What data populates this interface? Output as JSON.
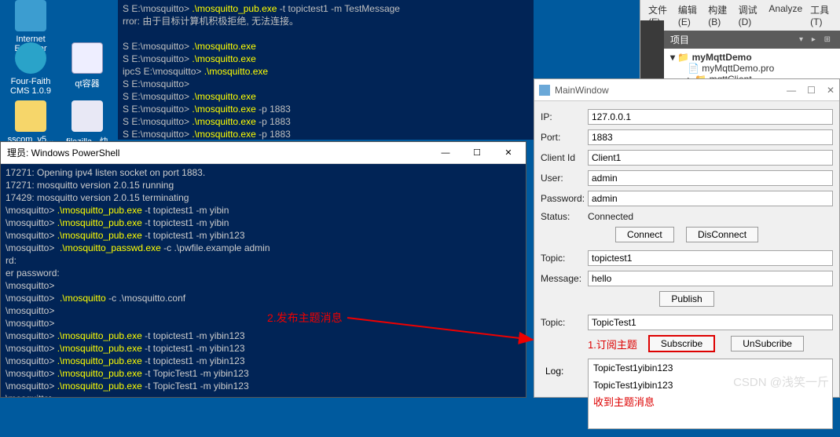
{
  "desktop": {
    "icons": [
      {
        "label": "Internet\nExplorer"
      },
      {
        "label": "Four-Faith\nCMS 1.0.9"
      },
      {
        "label": "qt容器"
      },
      {
        "label": "sscom_v5..."
      },
      {
        "label": "filezilla - 快 FF-..."
      }
    ]
  },
  "top_console": {
    "lines": [
      {
        "prompt": "S E:\\mosquitto> ",
        "cmd": ".\\mosquitto_pub.exe",
        "args": " -t topictest1 -m TestMessage"
      },
      {
        "plain": "rror: 由于目标计算机积极拒绝, 无法连接。"
      },
      {
        "plain": ""
      },
      {
        "prompt": "S E:\\mosquitto> ",
        "cmd": ".\\mosquitto.exe",
        "args": ""
      },
      {
        "prompt": "S E:\\mosquitto> ",
        "cmd": ".\\mosquitto.exe",
        "args": ""
      },
      {
        "prompt": "ipcS E:\\mosquitto> ",
        "cmd": ".\\mosquitto.exe",
        "args": ""
      },
      {
        "prompt": "S E:\\mosquitto> ",
        "cmd": "",
        "args": ""
      },
      {
        "prompt": "S E:\\mosquitto> ",
        "cmd": ".\\mosquitto.exe",
        "args": ""
      },
      {
        "prompt": "S E:\\mosquitto> ",
        "cmd": ".\\mosquitto.exe",
        "args": " -p 1883"
      },
      {
        "prompt": "S E:\\mosquitto> ",
        "cmd": ".\\mosquitto.exe",
        "args": " -p 1883"
      },
      {
        "prompt": "S E:\\mosquitto> ",
        "cmd": ".\\mosquitto.exe",
        "args": " -p 1883"
      }
    ]
  },
  "ps": {
    "title": "理员: Windows PowerShell",
    "min": "—",
    "max": "☐",
    "close": "✕",
    "lines": [
      {
        "plain": "17271: Opening ipv4 listen socket on port 1883."
      },
      {
        "plain": "17271: mosquitto version 2.0.15 running"
      },
      {
        "plain": "17429: mosquitto version 2.0.15 terminating"
      },
      {
        "prompt": "\\mosquitto> ",
        "cmd": ".\\mosquitto_pub.exe",
        "args": " -t topictest1 -m yibin"
      },
      {
        "prompt": "\\mosquitto> ",
        "cmd": ".\\mosquitto_pub.exe",
        "args": " -t topictest1 -m yibin"
      },
      {
        "prompt": "\\mosquitto> ",
        "cmd": ".\\mosquitto_pub.exe",
        "args": " -t topictest1 -m yibin123"
      },
      {
        "prompt": "\\mosquitto> ",
        "cmd": " .\\mosquitto_passwd.exe",
        "args": " -c .\\pwfile.example admin"
      },
      {
        "plain": "rd:"
      },
      {
        "plain": "er password:"
      },
      {
        "prompt": "\\mosquitto> ",
        "cmd": "",
        "args": ""
      },
      {
        "prompt": "\\mosquitto> ",
        "cmd": " .\\mosquitto",
        "args": " -c .\\mosquitto.conf"
      },
      {
        "prompt": "\\mosquitto> ",
        "cmd": "",
        "args": ""
      },
      {
        "prompt": "\\mosquitto> ",
        "cmd": "",
        "args": ""
      },
      {
        "prompt": "\\mosquitto> ",
        "cmd": ".\\mosquitto_pub.exe",
        "args": " -t topictest1 -m yibin123"
      },
      {
        "prompt": "\\mosquitto> ",
        "cmd": ".\\mosquitto_pub.exe",
        "args": " -t topictest1 -m yibin123"
      },
      {
        "prompt": "\\mosquitto> ",
        "cmd": ".\\mosquitto_pub.exe",
        "args": " -t topictest1 -m yibin123"
      },
      {
        "prompt": "\\mosquitto> ",
        "cmd": ".\\mosquitto_pub.exe",
        "args": " -t TopicTest1 -m yibin123"
      },
      {
        "prompt": "\\mosquitto> ",
        "cmd": ".\\mosquitto_pub.exe",
        "args": " -t TopicTest1 -m yibin123"
      },
      {
        "prompt": "\\mosquitto> ",
        "cmd": "_",
        "args": ""
      }
    ]
  },
  "ide": {
    "menus": [
      "文件(F)",
      "编辑(E)",
      "构建(B)",
      "调试(D)",
      "Analyze",
      "工具(T)"
    ],
    "project_header": "项目",
    "tree": {
      "folder": "myMqttDemo",
      "files": [
        "myMqttDemo.pro",
        "mqttClient"
      ]
    }
  },
  "mw": {
    "title": "MainWindow",
    "labels": {
      "ip": "IP:",
      "port": "Port:",
      "client": "Client Id",
      "user": "User:",
      "password": "Password:",
      "status": "Status:",
      "topic": "Topic:",
      "message": "Message:",
      "topic2": "Topic:",
      "log": "Log:"
    },
    "values": {
      "ip": "127.0.0.1",
      "port": "1883",
      "client": "Client1",
      "user": "admin",
      "password": "admin",
      "status": "Connected",
      "topic": "topictest1",
      "message": "hello",
      "topic2": "TopicTest1"
    },
    "buttons": {
      "connect": "Connect",
      "disconnect": "DisConnect",
      "publish": "Publish",
      "subscribe": "Subscribe",
      "unsubscribe": "UnSubcribe"
    },
    "sub_label": "1.订阅主题",
    "log_lines": [
      "TopicTest1yibin123",
      "TopicTest1yibin123"
    ],
    "received_note": "收到主题消息"
  },
  "annotations": {
    "publish": "2.发布主题消息"
  },
  "watermark": "CSDN @浅笑一斤"
}
